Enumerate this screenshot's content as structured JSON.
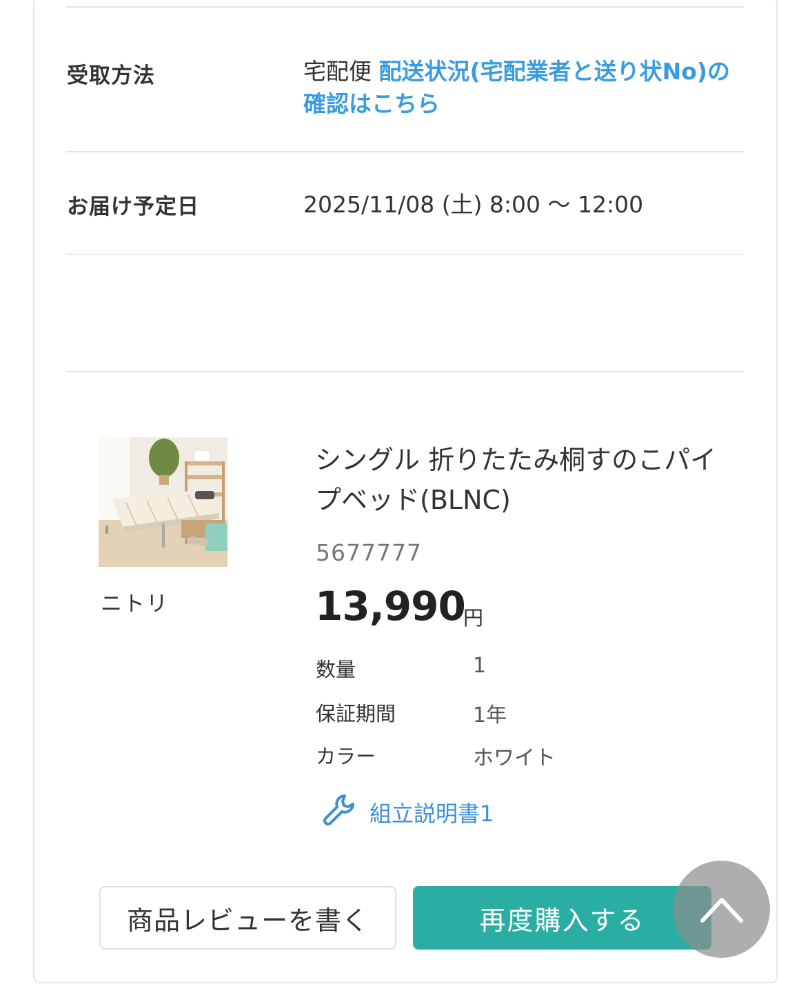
{
  "delivery": {
    "method_label": "受取方法",
    "method_value": "宅配便",
    "tracking_link": "配送状況(宅配業者と送り状No)の確認はこちら",
    "date_label": "お届け予定日",
    "date_value": "2025/11/08 (土) 8:00 ～ 12:00"
  },
  "product": {
    "maker": "ニトリ",
    "name": "シングル 折りたたみ桐すのこパイプベッド(BLNC)",
    "code": "5677777",
    "price": "13,990",
    "currency": "円",
    "specs": [
      {
        "key": "数量",
        "value": "1"
      },
      {
        "key": "保証期間",
        "value": "1年"
      },
      {
        "key": "カラー",
        "value": "ホワイト"
      }
    ],
    "manual_link": "組立説明書1"
  },
  "actions": {
    "review_button": "商品レビューを書く",
    "rebuy_button": "再度購入する"
  },
  "icons": {
    "manual": "wrench-icon",
    "scroll_top": "chevron-up-icon"
  },
  "colors": {
    "link": "#3b9be0",
    "primary_button": "#2aaea3"
  }
}
